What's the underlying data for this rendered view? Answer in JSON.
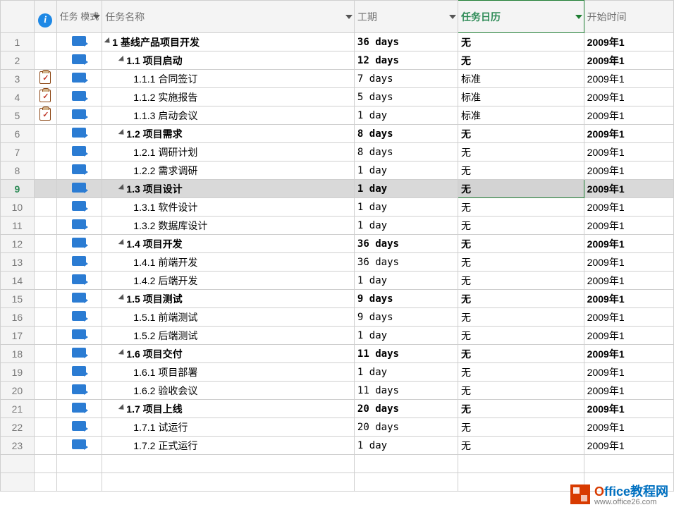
{
  "columns": {
    "info": "",
    "mode": "任务\n模式",
    "name": "任务名称",
    "duration": "工期",
    "calendar": "任务日历",
    "start": "开始时间"
  },
  "rows": [
    {
      "num": "1",
      "info": "",
      "mode": true,
      "indent": 0,
      "collapse": true,
      "bold": true,
      "name": "1 基线产品项目开发",
      "dur": "36 days",
      "cal": "无",
      "start": "2009年1"
    },
    {
      "num": "2",
      "info": "",
      "mode": true,
      "indent": 1,
      "collapse": true,
      "bold": true,
      "name": "1.1 项目启动",
      "dur": "12 days",
      "cal": "无",
      "start": "2009年1"
    },
    {
      "num": "3",
      "info": "clip",
      "mode": true,
      "indent": 2,
      "collapse": false,
      "bold": false,
      "name": "1.1.1 合同签订",
      "dur": "7 days",
      "cal": "标准",
      "start": "2009年1"
    },
    {
      "num": "4",
      "info": "clip",
      "mode": true,
      "indent": 2,
      "collapse": false,
      "bold": false,
      "name": "1.1.2 实施报告",
      "dur": "5 days",
      "cal": "标准",
      "start": "2009年1"
    },
    {
      "num": "5",
      "info": "clip",
      "mode": true,
      "indent": 2,
      "collapse": false,
      "bold": false,
      "name": "1.1.3 启动会议",
      "dur": "1 day",
      "cal": "标准",
      "start": "2009年1"
    },
    {
      "num": "6",
      "info": "",
      "mode": true,
      "indent": 1,
      "collapse": true,
      "bold": true,
      "name": "1.2 项目需求",
      "dur": "8 days",
      "cal": "无",
      "start": "2009年1"
    },
    {
      "num": "7",
      "info": "",
      "mode": true,
      "indent": 2,
      "collapse": false,
      "bold": false,
      "name": "1.2.1 调研计划",
      "dur": "8 days",
      "cal": "无",
      "start": "2009年1"
    },
    {
      "num": "8",
      "info": "",
      "mode": true,
      "indent": 2,
      "collapse": false,
      "bold": false,
      "name": "1.2.2 需求调研",
      "dur": "1 day",
      "cal": "无",
      "start": "2009年1"
    },
    {
      "num": "9",
      "info": "",
      "mode": true,
      "indent": 1,
      "collapse": true,
      "bold": true,
      "name": "1.3 项目设计",
      "dur": "1 day",
      "cal": "无",
      "start": "2009年1",
      "selected": true
    },
    {
      "num": "10",
      "info": "",
      "mode": true,
      "indent": 2,
      "collapse": false,
      "bold": false,
      "name": "1.3.1 软件设计",
      "dur": "1 day",
      "cal": "无",
      "start": "2009年1"
    },
    {
      "num": "11",
      "info": "",
      "mode": true,
      "indent": 2,
      "collapse": false,
      "bold": false,
      "name": "1.3.2 数据库设计",
      "dur": "1 day",
      "cal": "无",
      "start": "2009年1"
    },
    {
      "num": "12",
      "info": "",
      "mode": true,
      "indent": 1,
      "collapse": true,
      "bold": true,
      "name": "1.4 项目开发",
      "dur": "36 days",
      "cal": "无",
      "start": "2009年1"
    },
    {
      "num": "13",
      "info": "",
      "mode": true,
      "indent": 2,
      "collapse": false,
      "bold": false,
      "name": "1.4.1 前端开发",
      "dur": "36 days",
      "cal": "无",
      "start": "2009年1"
    },
    {
      "num": "14",
      "info": "",
      "mode": true,
      "indent": 2,
      "collapse": false,
      "bold": false,
      "name": "1.4.2 后端开发",
      "dur": "1 day",
      "cal": "无",
      "start": "2009年1"
    },
    {
      "num": "15",
      "info": "",
      "mode": true,
      "indent": 1,
      "collapse": true,
      "bold": true,
      "name": "1.5 项目测试",
      "dur": "9 days",
      "cal": "无",
      "start": "2009年1"
    },
    {
      "num": "16",
      "info": "",
      "mode": true,
      "indent": 2,
      "collapse": false,
      "bold": false,
      "name": "1.5.1 前端测试",
      "dur": "9 days",
      "cal": "无",
      "start": "2009年1"
    },
    {
      "num": "17",
      "info": "",
      "mode": true,
      "indent": 2,
      "collapse": false,
      "bold": false,
      "name": "1.5.2 后端测试",
      "dur": "1 day",
      "cal": "无",
      "start": "2009年1"
    },
    {
      "num": "18",
      "info": "",
      "mode": true,
      "indent": 1,
      "collapse": true,
      "bold": true,
      "name": "1.6 项目交付",
      "dur": "11 days",
      "cal": "无",
      "start": "2009年1"
    },
    {
      "num": "19",
      "info": "",
      "mode": true,
      "indent": 2,
      "collapse": false,
      "bold": false,
      "name": "1.6.1 项目部署",
      "dur": "1 day",
      "cal": "无",
      "start": "2009年1"
    },
    {
      "num": "20",
      "info": "",
      "mode": true,
      "indent": 2,
      "collapse": false,
      "bold": false,
      "name": "1.6.2 验收会议",
      "dur": "11 days",
      "cal": "无",
      "start": "2009年1"
    },
    {
      "num": "21",
      "info": "",
      "mode": true,
      "indent": 1,
      "collapse": true,
      "bold": true,
      "name": "1.7 项目上线",
      "dur": "20 days",
      "cal": "无",
      "start": "2009年1"
    },
    {
      "num": "22",
      "info": "",
      "mode": true,
      "indent": 2,
      "collapse": false,
      "bold": false,
      "name": "1.7.1 试运行",
      "dur": "20 days",
      "cal": "无",
      "start": "2009年1"
    },
    {
      "num": "23",
      "info": "",
      "mode": true,
      "indent": 2,
      "collapse": false,
      "bold": false,
      "name": "1.7.2 正式运行",
      "dur": "1 day",
      "cal": "无",
      "start": "2009年1"
    }
  ],
  "watermark": {
    "brand_prefix": "O",
    "brand_rest": "ffice教程网",
    "url": "www.office26.com"
  }
}
